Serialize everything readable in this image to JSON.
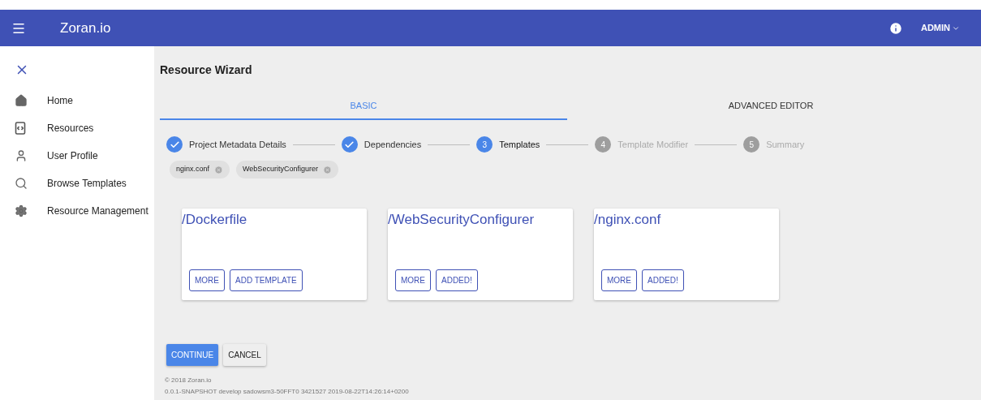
{
  "app_bar": {
    "brand": "Zoran.io",
    "user": "ADMIN"
  },
  "sidebar": {
    "items": [
      {
        "label": "Home"
      },
      {
        "label": "Resources"
      },
      {
        "label": "User Profile"
      },
      {
        "label": "Browse Templates"
      },
      {
        "label": "Resource Management"
      }
    ]
  },
  "title": "Resource Wizard",
  "tabs": [
    {
      "label": "BASIC",
      "selected": true
    },
    {
      "label": "ADVANCED EDITOR",
      "selected": false
    }
  ],
  "steps": [
    {
      "label": "Project Metadata Details",
      "completed": true,
      "selected": false
    },
    {
      "label": "Dependencies",
      "completed": true,
      "selected": false
    },
    {
      "number": "3",
      "label": "Templates",
      "completed": false,
      "selected": true
    },
    {
      "number": "4",
      "label": "Template Modifier",
      "completed": false,
      "selected": false
    },
    {
      "number": "5",
      "label": "Summary",
      "completed": false,
      "selected": false
    }
  ],
  "chips": [
    "nginx.conf",
    "WebSecurityConfigurer"
  ],
  "cards": [
    {
      "title": "/Dockerfile",
      "buttons": [
        "MORE",
        "ADD TEMPLATE"
      ]
    },
    {
      "title": "/WebSecurityConfigurer",
      "buttons": [
        "MORE",
        "ADDED!"
      ]
    },
    {
      "title": "/nginx.conf",
      "buttons": [
        "MORE",
        "ADDED!"
      ]
    }
  ],
  "actions": [
    {
      "label": "CONTINUE",
      "kind": "primary"
    },
    {
      "label": "CANCEL",
      "kind": "secondary"
    }
  ],
  "footer": [
    "© 2018 Zoran.io",
    "0.0.1-SNAPSHOT develop sadowsm3-50FFT0 3421527 2019-08-22T14:26:14+0200"
  ]
}
